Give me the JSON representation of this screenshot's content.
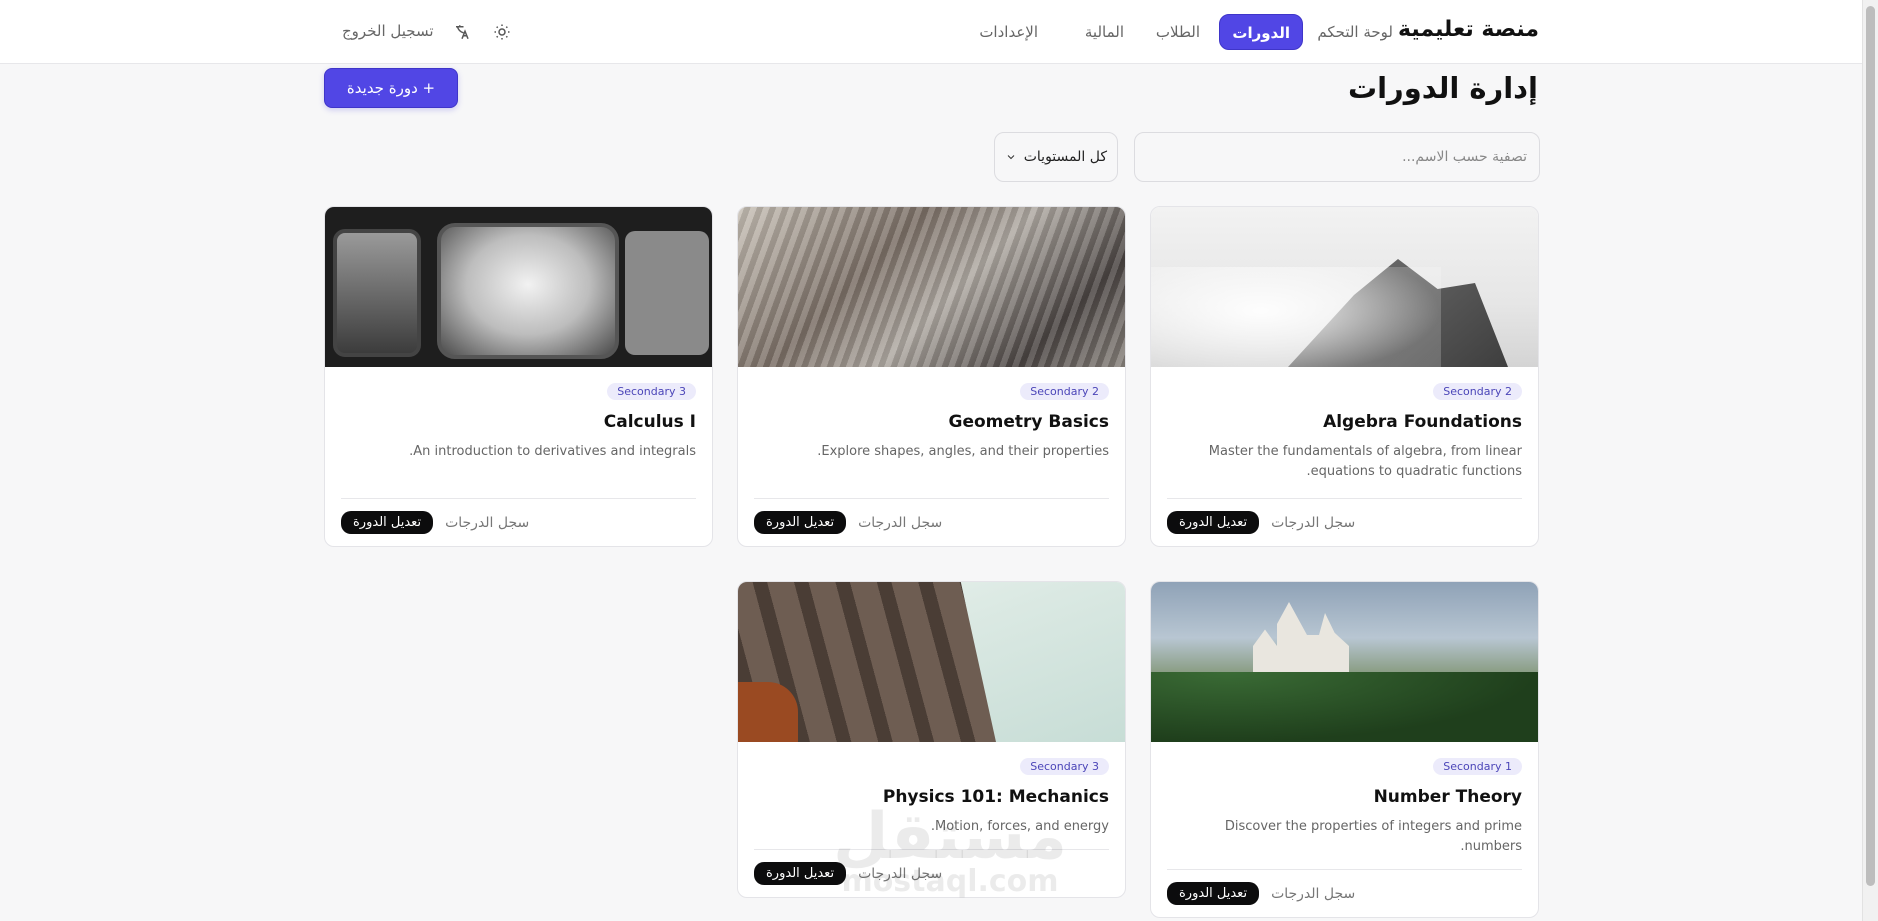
{
  "header": {
    "brand": "منصة تعليمية",
    "nav": {
      "dashboard": "لوحة التحكم",
      "courses": "الدورات",
      "students": "الطلاب",
      "finance": "المالية",
      "settings": "الإعدادات"
    },
    "logout": "تسجيل الخروج",
    "icons": {
      "theme": "sun-icon",
      "language": "translate-icon"
    }
  },
  "page": {
    "title": "إدارة الدورات",
    "new_course_label": "+ دورة جديدة"
  },
  "filters": {
    "search_placeholder": "تصفية حسب الاسم...",
    "level_selected": "كل المستويات"
  },
  "cards": [
    {
      "level": "Secondary 2",
      "title": "Algebra Foundations",
      "desc": "Master the fundamentals of algebra, from linear equations to quadratic functions.",
      "edit": "تعديل الدورة",
      "grades": "سجل الدرجات"
    },
    {
      "level": "Secondary 2",
      "title": "Geometry Basics",
      "desc": "Explore shapes, angles, and their properties.",
      "edit": "تعديل الدورة",
      "grades": "سجل الدرجات"
    },
    {
      "level": "Secondary 3",
      "title": "Calculus I",
      "desc": "An introduction to derivatives and integrals.",
      "edit": "تعديل الدورة",
      "grades": "سجل الدرجات"
    },
    {
      "level": "Secondary 1",
      "title": "Number Theory",
      "desc": "Discover the properties of integers and prime numbers.",
      "edit": "تعديل الدورة",
      "grades": "سجل الدرجات"
    },
    {
      "level": "Secondary 3",
      "title": "Physics 101: Mechanics",
      "desc": "Motion, forces, and energy.",
      "edit": "تعديل الدورة",
      "grades": "سجل الدرجات"
    }
  ],
  "watermark": {
    "text": "مستقل",
    "domain": "mostaql.com"
  },
  "colors": {
    "accent": "#5146e5",
    "dark_button": "#0c0c0d",
    "background": "#f7f7f8"
  }
}
